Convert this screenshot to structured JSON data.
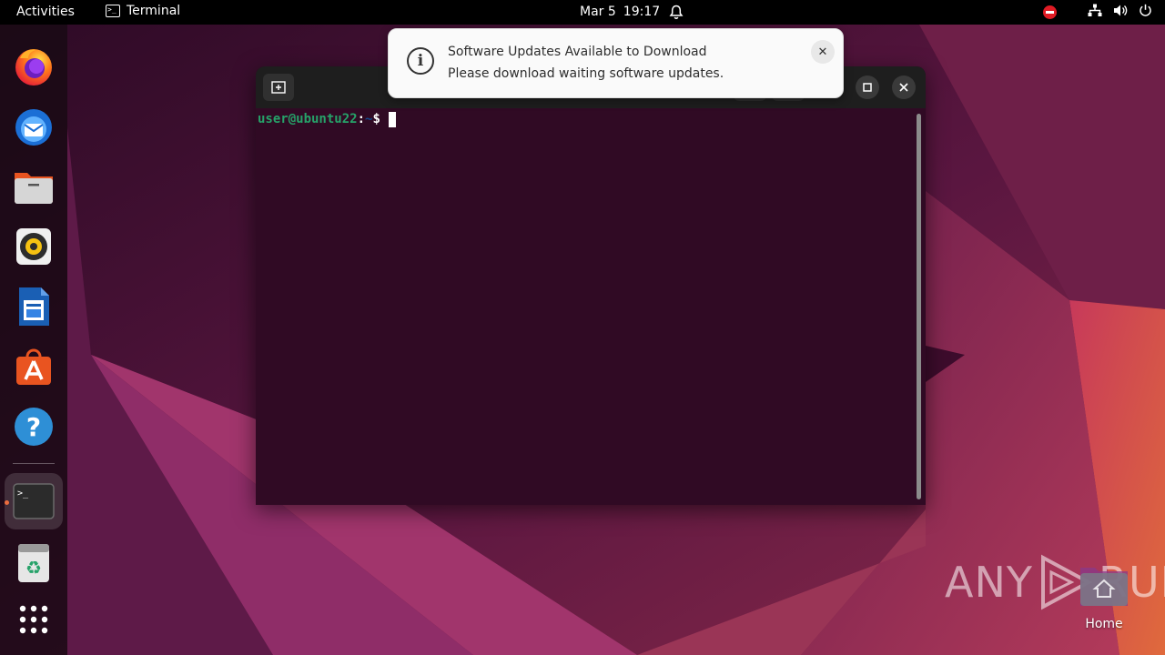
{
  "topbar": {
    "activities": "Activities",
    "app_name": "Terminal",
    "date": "Mar 5",
    "time": "19:17"
  },
  "dock": {
    "apps": [
      "firefox",
      "thunderbird",
      "files",
      "rhythmbox",
      "libreoffice-writer",
      "ubuntu-software",
      "help",
      "terminal",
      "trash",
      "show-applications"
    ],
    "active_app": "terminal"
  },
  "terminal": {
    "prompt_user": "user@ubuntu22",
    "prompt_colon": ":",
    "prompt_path": "~",
    "prompt_dollar": "$"
  },
  "notification": {
    "title": "Software Updates Available to Download",
    "body": "Please download waiting software updates.",
    "close_glyph": "✕"
  },
  "desktop": {
    "home_label": "Home"
  },
  "watermark": {
    "left": "ANY",
    "right": "RUN"
  },
  "colors": {
    "topbar": "#000000",
    "terminal_bg": "#300a24",
    "prompt_user": "#26a269",
    "prompt_path": "#12488b",
    "accent": "#e95420"
  }
}
